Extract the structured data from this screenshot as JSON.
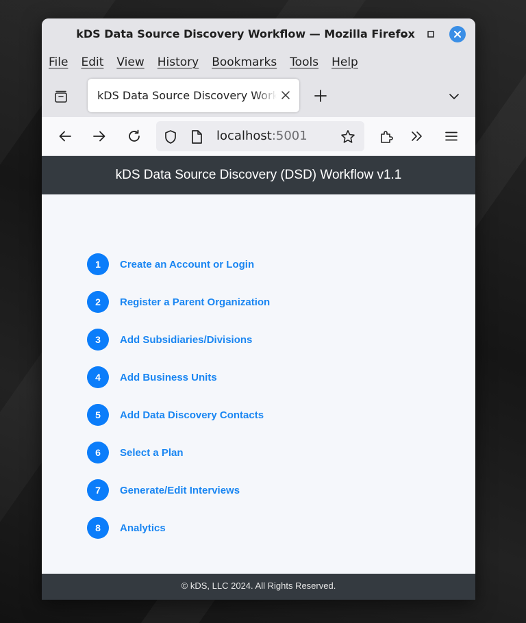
{
  "window": {
    "title": "kDS Data Source Discovery Workflow — Mozilla Firefox"
  },
  "menubar": {
    "items": [
      "File",
      "Edit",
      "View",
      "History",
      "Bookmarks",
      "Tools",
      "Help"
    ]
  },
  "tabs": {
    "active_label": "kDS Data Source Discovery Workflow"
  },
  "urlbar": {
    "host": "localhost",
    "port": ":5001"
  },
  "app": {
    "header_title": "kDS Data Source Discovery (DSD) Workflow v1.1",
    "steps": [
      {
        "number": "1",
        "label": "Create an Account or Login"
      },
      {
        "number": "2",
        "label": "Register a Parent Organization"
      },
      {
        "number": "3",
        "label": "Add Subsidiaries/Divisions"
      },
      {
        "number": "4",
        "label": "Add Business Units"
      },
      {
        "number": "5",
        "label": "Add Data Discovery Contacts"
      },
      {
        "number": "6",
        "label": "Select a Plan"
      },
      {
        "number": "7",
        "label": "Generate/Edit Interviews"
      },
      {
        "number": "8",
        "label": "Analytics"
      }
    ],
    "footer": "© kDS, LLC 2024. All Rights Reserved."
  },
  "colors": {
    "step_badge": "#0b7dfa",
    "step_link": "#1a86f2",
    "header_bg": "#343a40",
    "page_bg": "#f5f7fb"
  },
  "icons": {
    "window": [
      "minimize-icon",
      "maximize-icon",
      "close-icon"
    ],
    "tabstrip": [
      "tab-overview-icon",
      "tab-close-icon",
      "new-tab-plus-icon",
      "tab-list-chevron-icon"
    ],
    "navbar": [
      "back-arrow-icon",
      "forward-arrow-icon",
      "reload-icon",
      "shield-icon",
      "page-icon",
      "star-icon",
      "extensions-icon",
      "overflow-icon",
      "hamburger-menu-icon"
    ]
  }
}
